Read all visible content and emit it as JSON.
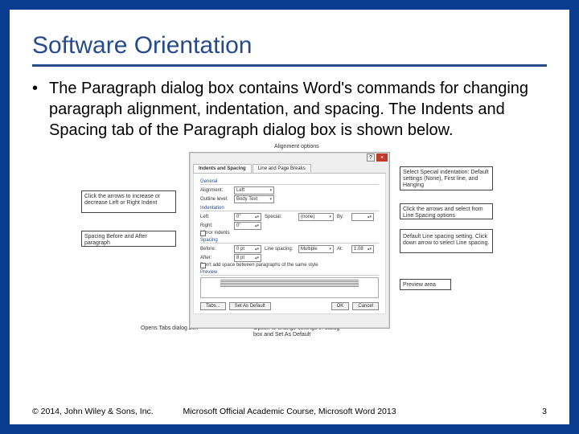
{
  "title": "Software Orientation",
  "body_text": "The Paragraph dialog box contains Word's commands for changing paragraph alignment, indentation, and spacing. The Indents and Spacing tab of the Paragraph dialog box is shown below.",
  "dialog": {
    "help": "?",
    "close": "×",
    "tabs": {
      "t1": "Indents and Spacing",
      "t2": "Line and Page Breaks"
    },
    "general_label": "General",
    "alignment_label": "Alignment:",
    "alignment_value": "Left",
    "outline_label": "Outline level:",
    "outline_value": "Body Text",
    "indent_label": "Indentation",
    "left_label": "Left:",
    "left_value": "0\"",
    "right_label": "Right:",
    "right_value": "0\"",
    "special_label": "Special:",
    "special_value": "(none)",
    "by_label": "By:",
    "by_value": "",
    "mirror_label": "Mirror indents",
    "spacing_label": "Spacing",
    "before_label": "Before:",
    "before_value": "0 pt",
    "after_label": "After:",
    "after_value": "8 pt",
    "linesp_label": "Line spacing:",
    "linesp_value": "Multiple",
    "at_label": "At:",
    "at_value": "1.08",
    "nospace_label": "Don't add space between paragraphs of the same style",
    "preview_label": "Preview",
    "tabs_btn": "Tabs...",
    "default_btn": "Set As Default",
    "ok_btn": "OK",
    "cancel_btn": "Cancel"
  },
  "callouts": {
    "alignment": "Alignment options",
    "indent_arrows": "Click the arrows to increase or decrease Left or Right Indent",
    "spacing_before_after": "Spacing Before and After paragraph",
    "tabs_dialog": "Opens Tabs dialog box",
    "set_default": "Option to change settings in dialog box and Set As Default",
    "special_indent": "Select Special indentation: Default settings (None), First line, and Hanging",
    "by_arrows": "Click the arrows and select from Line Spacing options",
    "line_spacing_default": "Default Line spacing setting. Click down arrow to select Line spacing.",
    "preview_area": "Preview area"
  },
  "footer": {
    "copyright": "© 2014, John Wiley & Sons, Inc.",
    "course": "Microsoft Official Academic Course, Microsoft Word 2013",
    "page": "3"
  }
}
